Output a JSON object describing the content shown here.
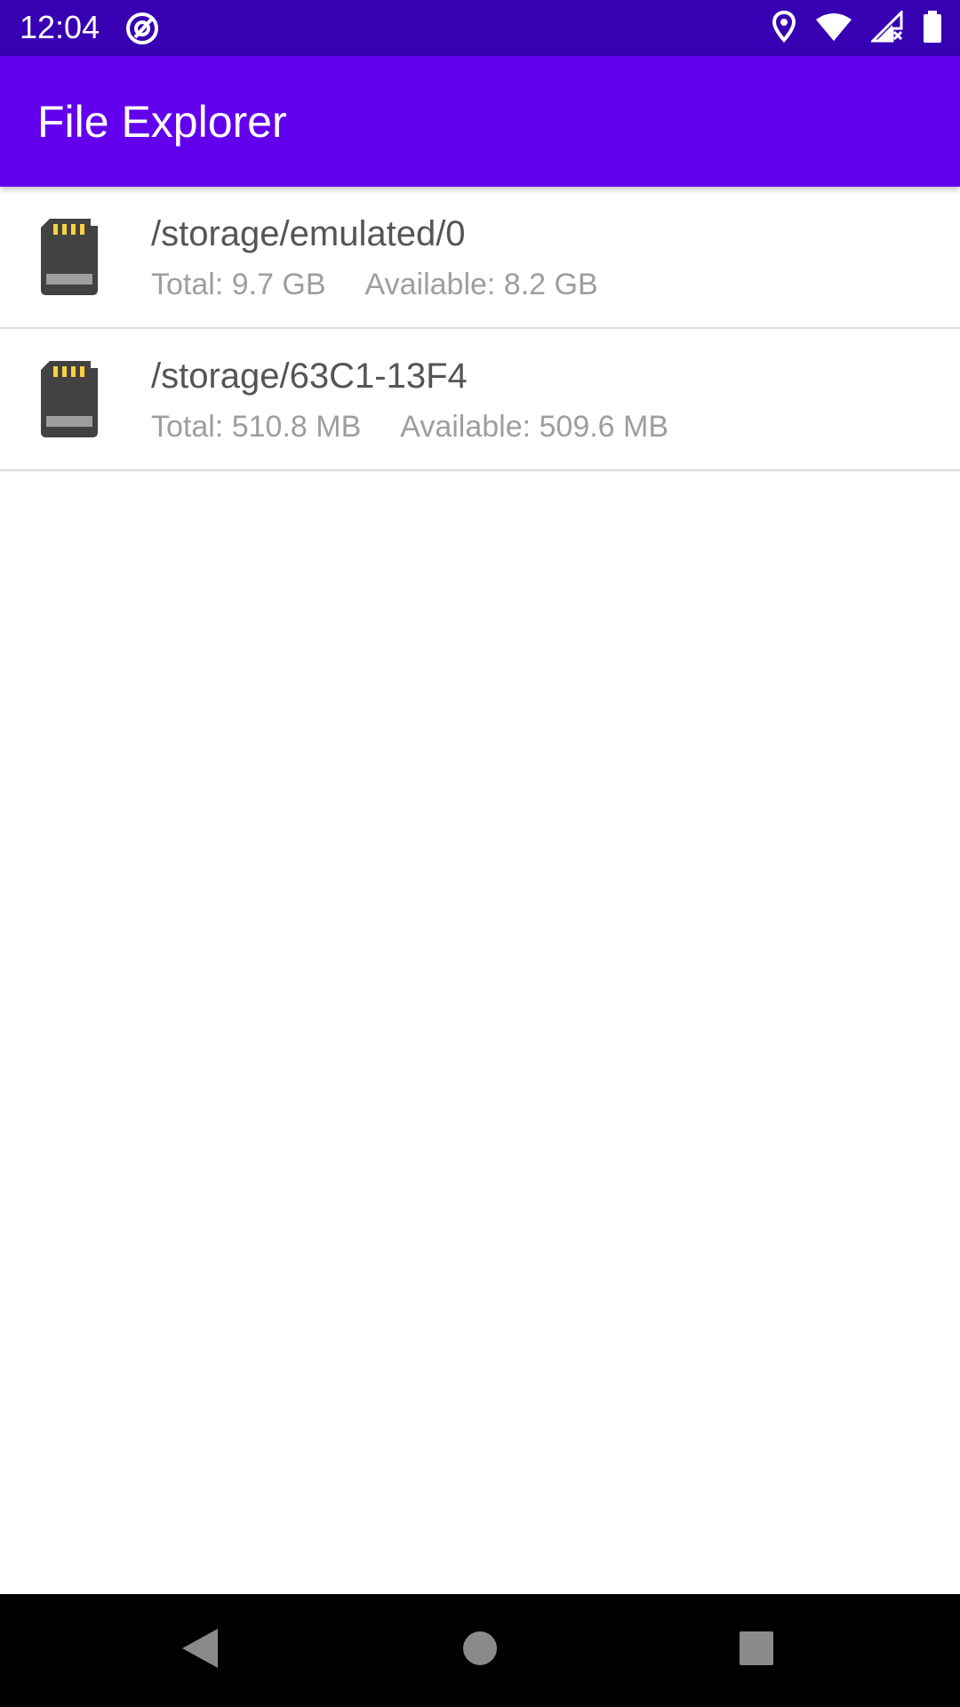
{
  "status_bar": {
    "time": "12:04",
    "left_icon": "at-sign-icon",
    "right_icons": [
      "location-icon",
      "wifi-icon",
      "signal-icon",
      "battery-icon"
    ]
  },
  "app_bar": {
    "title": "File Explorer"
  },
  "storage_list": {
    "items": [
      {
        "path": "/storage/emulated/0",
        "total": "Total: 9.7 GB",
        "available": "Available: 8.2 GB",
        "icon": "sd-card-icon"
      },
      {
        "path": "/storage/63C1-13F4",
        "total": "Total: 510.8 MB",
        "available": "Available: 509.6 MB",
        "icon": "sd-card-icon"
      }
    ]
  },
  "nav_bar": {
    "buttons": [
      "back-icon",
      "home-icon",
      "recents-icon"
    ]
  },
  "colors": {
    "status_bar": "#3700B3",
    "app_bar": "#6200EE",
    "sd_card_body": "#424242",
    "sd_card_contacts": "#F9D23C"
  }
}
